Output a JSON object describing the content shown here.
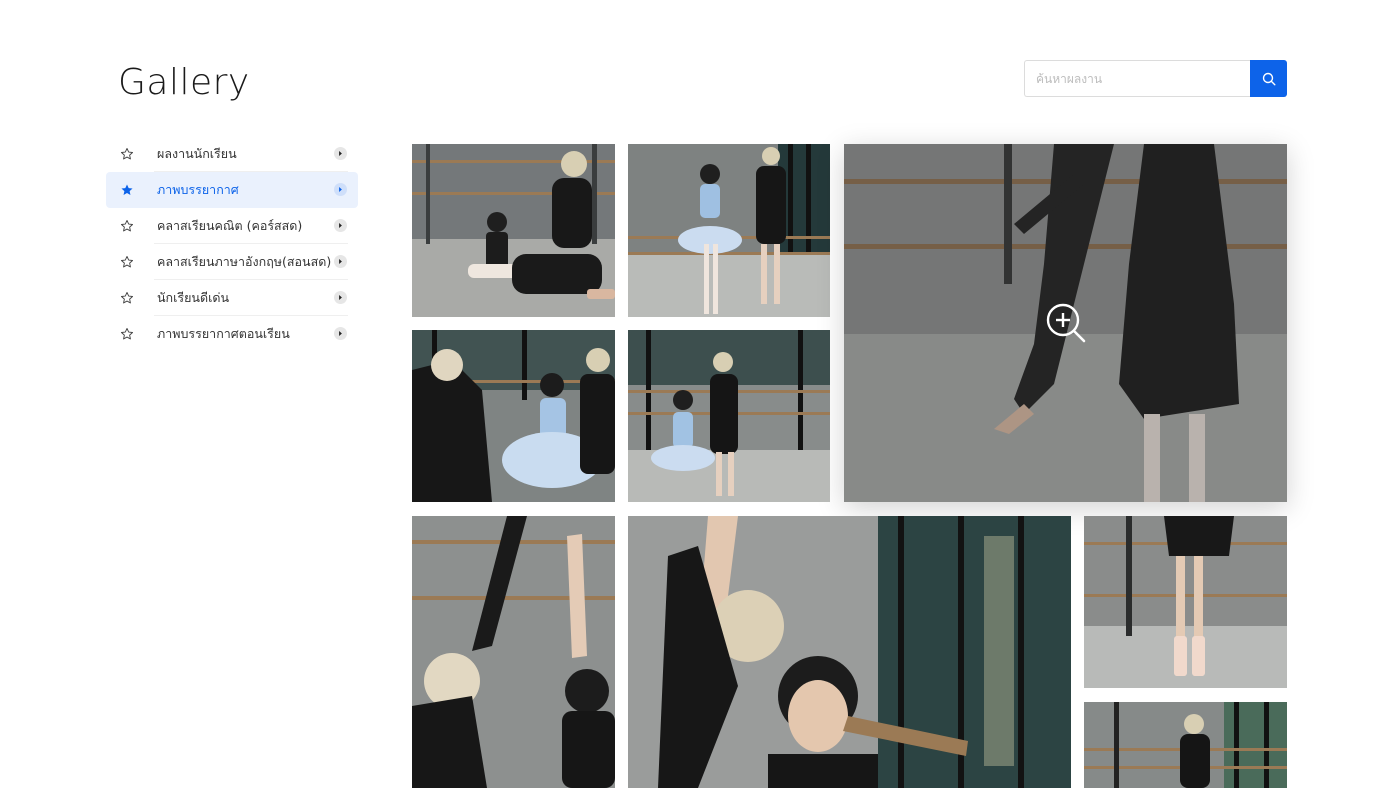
{
  "page": {
    "title": "Gallery"
  },
  "search": {
    "placeholder": "ค้นหาผลงาน",
    "value": "",
    "button_icon": "search-icon"
  },
  "sidebar": {
    "items": [
      {
        "label": "ผลงานนักเรียน",
        "active": false
      },
      {
        "label": "ภาพบรรยากาศ",
        "active": true
      },
      {
        "label": "คลาสเรียนคณิต (คอร์สสด)",
        "active": false
      },
      {
        "label": "คลาสเรียนภาษาอังกฤษ(สอนสด)",
        "active": false
      },
      {
        "label": "นักเรียนดีเด่น",
        "active": false
      },
      {
        "label": "ภาพบรรยากาศตอนเรียน",
        "active": false
      }
    ]
  },
  "gallery": {
    "images": [
      {
        "scene": "ballet-teacher-kneeling-with-student"
      },
      {
        "scene": "ballet-dancers-at-barre"
      },
      {
        "scene": "ballet-legs-closeup",
        "hovered": true,
        "overlay_icon": "zoom-in-icon"
      },
      {
        "scene": "teacher-adjusting-tutu"
      },
      {
        "scene": "teacher-and-student-dancing"
      },
      {
        "scene": "raised-arms-at-barre"
      },
      {
        "scene": "student-stretching-portrait"
      },
      {
        "scene": "pointe-shoes-closeup"
      },
      {
        "scene": "teacher-at-barre"
      }
    ]
  },
  "colors": {
    "accent": "#0d63e9",
    "active_bg": "#eaf1fd",
    "overlay": "rgba(60,60,60,0.28)"
  }
}
